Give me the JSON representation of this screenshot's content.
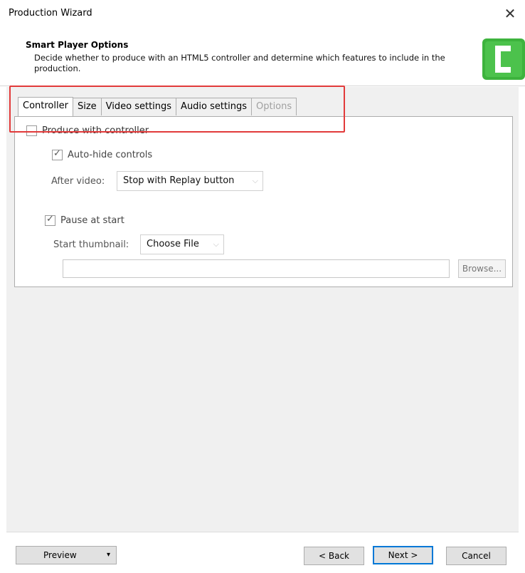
{
  "window": {
    "title": "Production Wizard",
    "close_icon": "✕"
  },
  "header": {
    "title": "Smart Player Options",
    "description": "Decide whether to produce with an HTML5 controller and determine which features to include in the production.",
    "logo_icon": "camtasia-logo-icon",
    "logo_color": "#3db33d"
  },
  "tabs": [
    {
      "label": "Controller",
      "state": "active"
    },
    {
      "label": "Size",
      "state": "normal"
    },
    {
      "label": "Video settings",
      "state": "normal"
    },
    {
      "label": "Audio settings",
      "state": "normal"
    },
    {
      "label": "Options",
      "state": "disabled"
    }
  ],
  "controller": {
    "produce_with_controller": {
      "label": "Produce with controller",
      "checked": false
    },
    "auto_hide": {
      "label": "Auto-hide controls",
      "checked": true
    },
    "after_video": {
      "label": "After video:",
      "value": "Stop with Replay button"
    },
    "pause_at_start": {
      "label": "Pause at start",
      "checked": true
    },
    "start_thumbnail": {
      "label": "Start thumbnail:",
      "value": "Choose File"
    },
    "file_path": "",
    "browse_label": "Browse..."
  },
  "footer": {
    "preview_label": "Preview",
    "preview_arrow": "▾",
    "back_label": "< Back",
    "next_label": "Next >",
    "cancel_label": "Cancel"
  },
  "colors": {
    "highlight_border": "#e23a3a",
    "default_button_border": "#0078d7"
  }
}
